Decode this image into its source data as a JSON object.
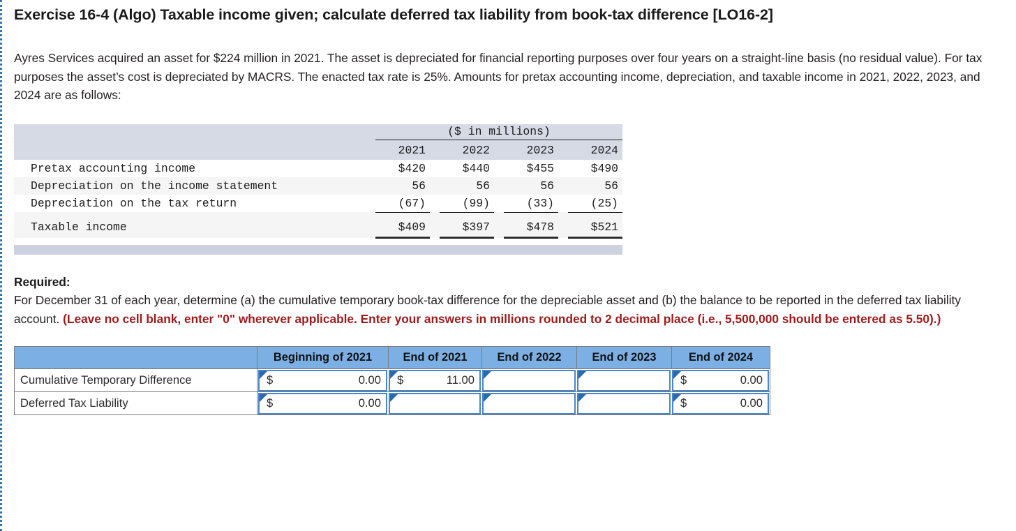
{
  "question": {
    "title": "Exercise 16-4 (Algo) Taxable income given; calculate deferred tax liability from book-tax difference [LO16-2]",
    "body": "Ayres Services acquired an asset for $224 million in 2021. The asset is depreciated for financial reporting purposes over four years on a straight-line basis (no residual value). For tax purposes the asset’s cost is depreciated by MACRS. The enacted tax rate is 25%. Amounts for pretax accounting income, depreciation, and taxable income in 2021, 2022, 2023, and 2024 are as follows:"
  },
  "exhibit": {
    "units_header": "($ in millions)",
    "year_columns": [
      "2021",
      "2022",
      "2023",
      "2024"
    ],
    "rows": [
      {
        "label": "Pretax accounting income",
        "values": [
          "$420",
          "$440",
          "$455",
          "$490"
        ]
      },
      {
        "label": "Depreciation on the income statement",
        "values": [
          "56",
          "56",
          "56",
          "56"
        ]
      },
      {
        "label": "Depreciation on the tax return",
        "values": [
          "(67)",
          "(99)",
          "(33)",
          "(25)"
        ]
      },
      {
        "label": "Taxable income",
        "values": [
          "$409",
          "$397",
          "$478",
          "$521"
        ]
      }
    ]
  },
  "required": {
    "label": "Required:",
    "text": "For December 31 of each year, determine (a) the cumulative temporary book-tax difference for the depreciable asset and (b) the balance to be reported in the deferred tax liability account. ",
    "emphasis": "(Leave no cell blank, enter \"0\" wherever applicable. Enter your answers in millions rounded to 2 decimal place (i.e., 5,500,000 should be entered as 5.50).)"
  },
  "answer_table": {
    "headers": [
      "",
      "Beginning of 2021",
      "End of 2021",
      "End of 2022",
      "End of 2023",
      "End of 2024"
    ],
    "rows": [
      {
        "label": "Cumulative Temporary Difference",
        "cells": [
          {
            "dollar": "$",
            "value": "0.00"
          },
          {
            "dollar": "$",
            "value": "11.00"
          },
          {
            "dollar": "",
            "value": ""
          },
          {
            "dollar": "",
            "value": ""
          },
          {
            "dollar": "$",
            "value": "0.00"
          }
        ]
      },
      {
        "label": "Deferred Tax Liability",
        "cells": [
          {
            "dollar": "$",
            "value": "0.00"
          },
          {
            "dollar": "",
            "value": ""
          },
          {
            "dollar": "",
            "value": ""
          },
          {
            "dollar": "",
            "value": ""
          },
          {
            "dollar": "$",
            "value": "0.00"
          }
        ]
      }
    ]
  },
  "colors": {
    "header_blue": "#7cb0e5",
    "input_border": "#4a86c8",
    "marker_blue": "#2a69ad",
    "exhibit_band": "#d5dae5",
    "emphasis_red": "#9e1b1b",
    "page_border": "#3573b9"
  }
}
